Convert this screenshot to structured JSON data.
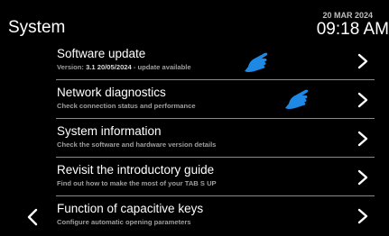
{
  "header": {
    "title": "System",
    "date": "20 MAR 2024",
    "time": "09:18 AM"
  },
  "menu": {
    "items": [
      {
        "title": "Software update",
        "subtitle_prefix": "Version: ",
        "subtitle_highlight": "3.1 20/05/2024",
        "subtitle_suffix": " - update available",
        "chevron_icon": "chevron-right-icon",
        "pointer_icon": "pointing-hand-icon"
      },
      {
        "title": "Network diagnostics",
        "subtitle": "Check connection status and performance",
        "chevron_icon": "chevron-right-icon",
        "pointer_icon": "pointing-hand-icon"
      },
      {
        "title": "System information",
        "subtitle": "Check the software and hardware version details",
        "chevron_icon": "chevron-right-icon"
      },
      {
        "title": "Revisit the introductory guide",
        "subtitle": "Find out how to make the most of your TAB S UP",
        "chevron_icon": "chevron-right-icon"
      },
      {
        "title": "Function of capacitive keys",
        "subtitle": "Configure automatic opening parameters",
        "chevron_icon": "chevron-right-icon"
      }
    ]
  },
  "navigation": {
    "back_icon": "chevron-left-icon"
  },
  "colors": {
    "background": "#000000",
    "text": "#ffffff",
    "subtitle": "#9e9e9e",
    "divider": "#8a8a8a",
    "hand_icon": "#1e88e5"
  }
}
